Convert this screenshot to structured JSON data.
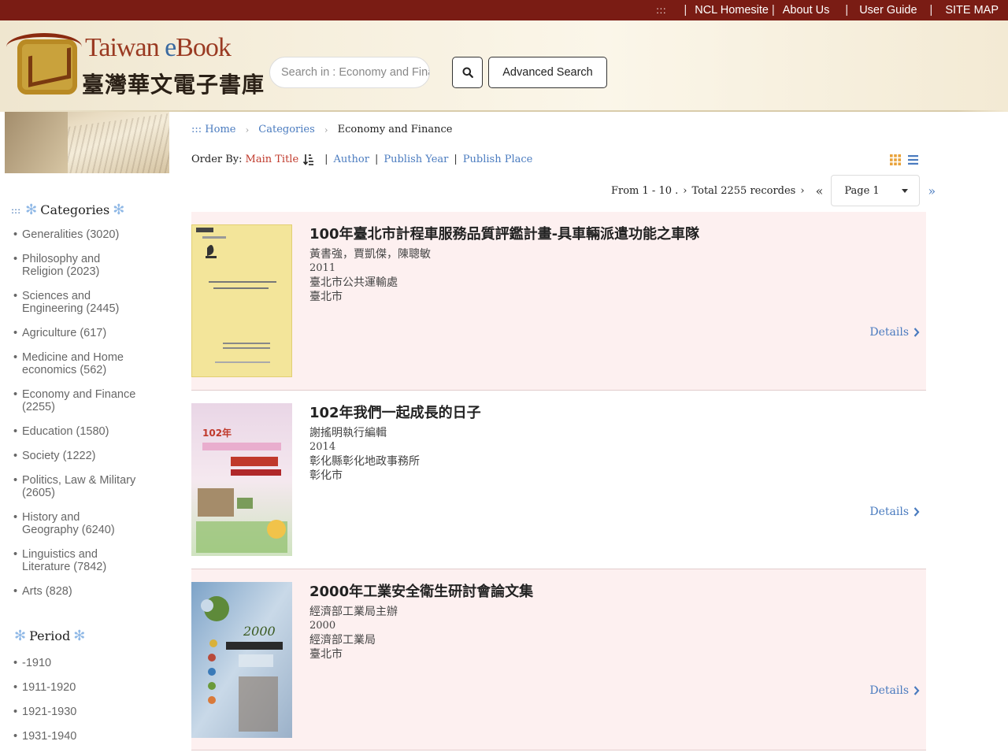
{
  "topbar": {
    "accesskey": ":::",
    "links": [
      "NCL Homesite",
      "About Us",
      "User Guide",
      "SITE MAP"
    ]
  },
  "header": {
    "logo_en_prefix": "Taiwan ",
    "logo_en_e": "e",
    "logo_en_suffix": "Book",
    "logo_zh": "臺灣華文電子書庫",
    "search_placeholder": "Search in : Economy and Finance",
    "search_button_icon": "search-icon",
    "advanced_search_label": "Advanced Search"
  },
  "sidebar": {
    "categories_dots": ":::",
    "categories_title": "Categories",
    "categories": [
      {
        "label": "Generalities (3020)"
      },
      {
        "label": "Philosophy and Religion (2023)"
      },
      {
        "label": "Sciences and Engineering (2445)"
      },
      {
        "label": "Agriculture (617)"
      },
      {
        "label": "Medicine and Home economics (562)"
      },
      {
        "label": "Economy and Finance (2255)"
      },
      {
        "label": "Education (1580)"
      },
      {
        "label": "Society (1222)"
      },
      {
        "label": "Politics, Law & Military (2605)"
      },
      {
        "label": "History and Geography (6240)"
      },
      {
        "label": "Linguistics and Literature (7842)"
      },
      {
        "label": "Arts (828)"
      }
    ],
    "period_title": "Period",
    "periods": [
      "-1910",
      "1911-1920",
      "1921-1930",
      "1931-1940"
    ]
  },
  "breadcrumb": {
    "home_prefix": ":::",
    "home": "Home",
    "categories": "Categories",
    "current": "Economy and Finance"
  },
  "orderby": {
    "label": "Order By:",
    "active": "Main Title",
    "options": [
      "Author",
      "Publish Year",
      "Publish Place"
    ]
  },
  "pager": {
    "range": "From 1 - 10 .",
    "total": "Total 2255 recordes",
    "page_label": "Page 1"
  },
  "results": [
    {
      "title": "100年臺北市計程車服務品質評鑑計畫-具車輛派遣功能之車隊",
      "author": "黃書強，賈凱傑，陳聰敏",
      "year": "2011",
      "publisher": "臺北市公共運輸處",
      "place": "臺北市",
      "details": "Details"
    },
    {
      "title": "102年我們一起成長的日子",
      "author": "謝搖明執行編輯",
      "year": "2014",
      "publisher": "彰化縣彰化地政事務所",
      "place": "彰化市",
      "details": "Details"
    },
    {
      "title": "2000年工業安全衛生研討會論文集",
      "author": "經濟部工業局主辦",
      "year": "2000",
      "publisher": "經濟部工業局",
      "place": "臺北市",
      "details": "Details"
    }
  ],
  "colors": {
    "topbar": "#7a1c14",
    "link": "#4a7bbf",
    "active_sort": "#c0392b",
    "result_bg": "#fdf0f0",
    "grid_icon": "#e8a23a"
  }
}
